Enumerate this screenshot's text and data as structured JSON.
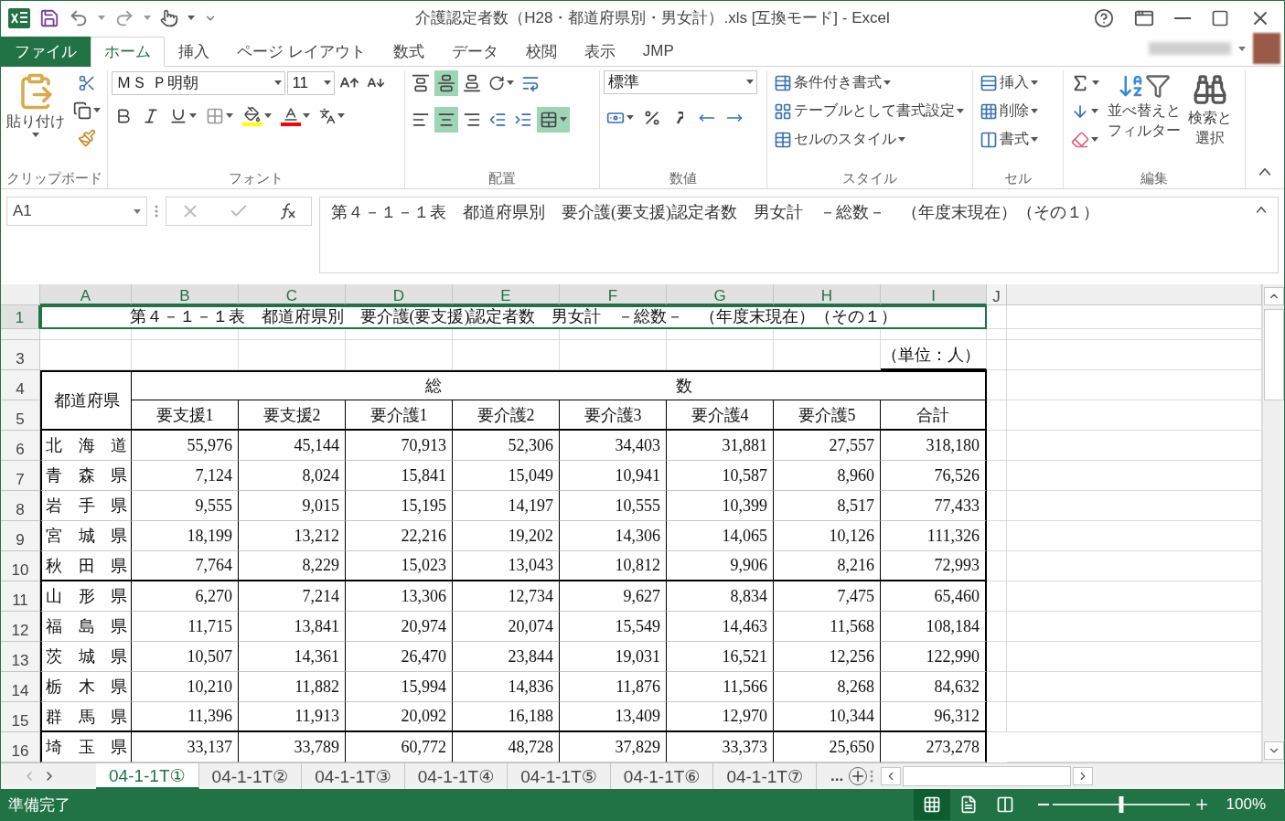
{
  "title_bar": {
    "title": "介護認定者数（H28・都道府県別・男女計）.xls  [互換モード] - Excel"
  },
  "ribbon_tabs": [
    {
      "label": "ファイル",
      "kind": "file",
      "selected": false
    },
    {
      "label": "ホーム",
      "kind": "tab",
      "selected": true
    },
    {
      "label": "挿入",
      "kind": "tab",
      "selected": false
    },
    {
      "label": "ページ レイアウト",
      "kind": "tab",
      "selected": false
    },
    {
      "label": "数式",
      "kind": "tab",
      "selected": false
    },
    {
      "label": "データ",
      "kind": "tab",
      "selected": false
    },
    {
      "label": "校閲",
      "kind": "tab",
      "selected": false
    },
    {
      "label": "表示",
      "kind": "tab",
      "selected": false
    },
    {
      "label": "JMP",
      "kind": "tab",
      "selected": false
    }
  ],
  "clipboard": {
    "paste": "貼り付け",
    "label": "クリップボード"
  },
  "font": {
    "name": "ＭＳ Ｐ明朝",
    "size": "11",
    "label": "フォント"
  },
  "alignment": {
    "label": "配置",
    "vertical": [
      {
        "selected": false
      },
      {
        "selected": true
      },
      {
        "selected": false
      }
    ],
    "horizontal": [
      {
        "selected": false
      },
      {
        "selected": true
      },
      {
        "selected": false
      }
    ],
    "merge": {
      "selected": true
    }
  },
  "number": {
    "format": "標準",
    "label": "数値"
  },
  "styles": {
    "items": [
      "条件付き書式",
      "テーブルとして書式設定",
      "セルのスタイル"
    ],
    "label": "スタイル"
  },
  "cells": {
    "items": [
      "挿入",
      "削除",
      "書式"
    ],
    "label": "セル"
  },
  "editing": {
    "sort": [
      "並べ替えと",
      "フィルター"
    ],
    "find": [
      "検索と",
      "選択"
    ],
    "label": "編集"
  },
  "formula_bar": {
    "name_box": "A1",
    "formula": "第４－１－１表　都道府県別　要介護(要支援)認定者数　男女計　－総数－　（年度末現在）（その１）"
  },
  "sheet": {
    "columns": [
      {
        "label": "A",
        "selected": true
      },
      {
        "label": "B",
        "selected": true
      },
      {
        "label": "C",
        "selected": true
      },
      {
        "label": "D",
        "selected": true
      },
      {
        "label": "E",
        "selected": true
      },
      {
        "label": "F",
        "selected": true
      },
      {
        "label": "G",
        "selected": true
      },
      {
        "label": "H",
        "selected": true
      },
      {
        "label": "I",
        "selected": true
      },
      {
        "label": "J",
        "selected": false
      }
    ],
    "top_rows": [
      {
        "number": "1",
        "selected": true
      },
      {
        "number": "3",
        "selected": false
      },
      {
        "number": "4",
        "selected": false
      },
      {
        "number": "5",
        "selected": false
      }
    ],
    "title_cell": {
      "text": "第４－１－１表　都道府県別　要介護(要支援)認定者数　男女計　－総数－　（年度末現在）（その１）",
      "selected": true
    },
    "unit": "（単位：人）",
    "header": {
      "prefecture": "都道府県",
      "group": [
        "総",
        "数"
      ],
      "columns": [
        "要支援1",
        "要支援2",
        "要介護1",
        "要介護2",
        "要介護3",
        "要介護4",
        "要介護5",
        "合計"
      ]
    },
    "rows": [
      {
        "row": "6",
        "prefecture": "北 海 道",
        "values": [
          "55,976",
          "45,144",
          "70,913",
          "52,306",
          "34,403",
          "31,881",
          "27,557",
          "318,180"
        ]
      },
      {
        "row": "7",
        "prefecture": "青 森 県",
        "values": [
          "7,124",
          "8,024",
          "15,841",
          "15,049",
          "10,941",
          "10,587",
          "8,960",
          "76,526"
        ]
      },
      {
        "row": "8",
        "prefecture": "岩 手 県",
        "values": [
          "9,555",
          "9,015",
          "15,195",
          "14,197",
          "10,555",
          "10,399",
          "8,517",
          "77,433"
        ]
      },
      {
        "row": "9",
        "prefecture": "宮 城 県",
        "values": [
          "18,199",
          "13,212",
          "22,216",
          "19,202",
          "14,306",
          "14,065",
          "10,126",
          "111,326"
        ]
      },
      {
        "row": "10",
        "prefecture": "秋 田 県",
        "values": [
          "7,764",
          "8,229",
          "15,023",
          "13,043",
          "10,812",
          "9,906",
          "8,216",
          "72,993"
        ]
      },
      {
        "row": "11",
        "prefecture": "山 形 県",
        "values": [
          "6,270",
          "7,214",
          "13,306",
          "12,734",
          "9,627",
          "8,834",
          "7,475",
          "65,460"
        ]
      },
      {
        "row": "12",
        "prefecture": "福 島 県",
        "values": [
          "11,715",
          "13,841",
          "20,974",
          "20,074",
          "15,549",
          "14,463",
          "11,568",
          "108,184"
        ]
      },
      {
        "row": "13",
        "prefecture": "茨 城 県",
        "values": [
          "10,507",
          "14,361",
          "26,470",
          "23,844",
          "19,031",
          "16,521",
          "12,256",
          "122,990"
        ]
      },
      {
        "row": "14",
        "prefecture": "栃 木 県",
        "values": [
          "10,210",
          "11,882",
          "15,994",
          "14,836",
          "11,876",
          "11,566",
          "8,268",
          "84,632"
        ]
      },
      {
        "row": "15",
        "prefecture": "群 馬 県",
        "values": [
          "11,396",
          "11,913",
          "20,092",
          "16,188",
          "13,409",
          "12,970",
          "10,344",
          "96,312"
        ]
      },
      {
        "row": "16",
        "prefecture": "埼 玉 県",
        "values": [
          "33,137",
          "33,789",
          "60,772",
          "48,728",
          "37,829",
          "33,373",
          "25,650",
          "273,278"
        ]
      }
    ]
  },
  "sheet_tabs": [
    {
      "label": "04-1-1T①",
      "selected": true
    },
    {
      "label": "04-1-1T②",
      "selected": false
    },
    {
      "label": "04-1-1T③",
      "selected": false
    },
    {
      "label": "04-1-1T④",
      "selected": false
    },
    {
      "label": "04-1-1T⑤",
      "selected": false
    },
    {
      "label": "04-1-1T⑥",
      "selected": false
    },
    {
      "label": "04-1-1T⑦",
      "selected": false
    }
  ],
  "more_tabs": "...",
  "status_bar": {
    "status": "準備完了",
    "views": [
      {
        "selected": true
      },
      {
        "selected": false
      },
      {
        "selected": false
      }
    ],
    "zoom": {
      "level": 0.5
    },
    "zoom_text": "100%"
  }
}
